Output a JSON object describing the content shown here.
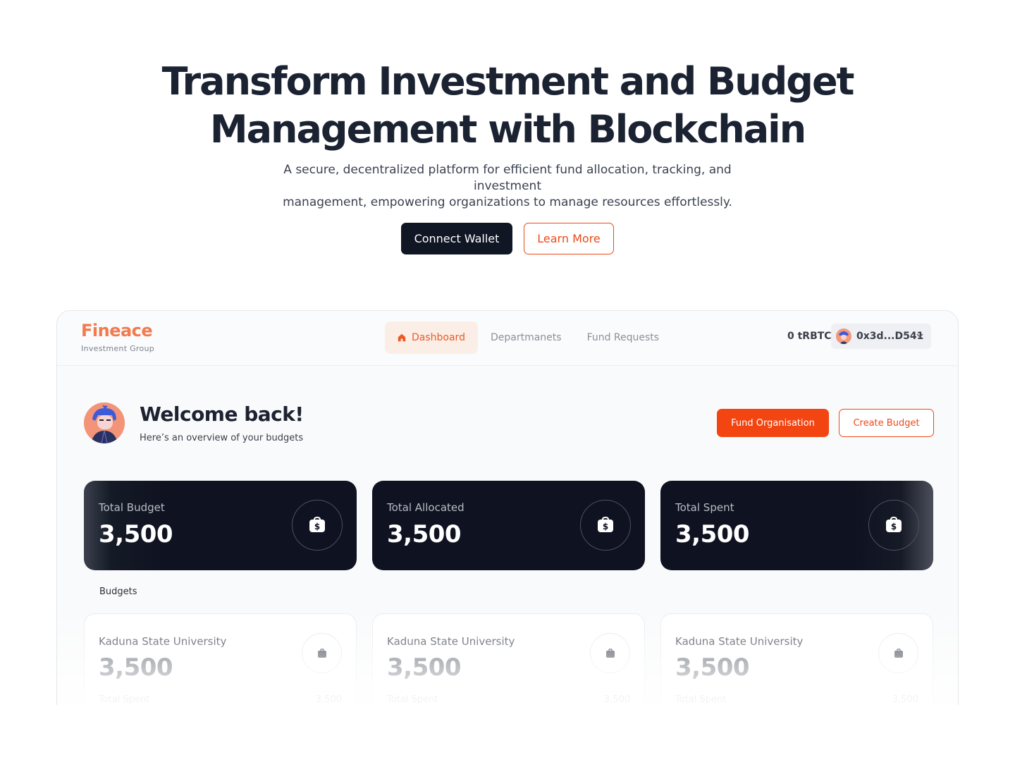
{
  "hero": {
    "title_line1": "Transform Investment and Budget",
    "title_line2": "Management with Blockchain",
    "subtitle_line1": "A secure, decentralized platform for efficient fund allocation, tracking, and investment",
    "subtitle_line2": "management, empowering organizations to manage resources effortlessly.",
    "connect_label": "Connect Wallet",
    "learn_label": "Learn More"
  },
  "app": {
    "logo": {
      "name": "Fineace",
      "tagline": "Investment Group"
    },
    "nav": [
      {
        "label": "Dashboard",
        "icon": "home-icon",
        "active": true
      },
      {
        "label": "Departmanets",
        "active": false
      },
      {
        "label": "Fund Requests",
        "active": false
      }
    ],
    "balance": "0 tRBTC",
    "wallet": {
      "address": "0x3d...D541",
      "icon": "chevron-down-icon"
    },
    "welcome": {
      "title": "Welcome back!",
      "subtitle": "Here’s an overview of your budgets"
    },
    "actions": {
      "fund_label": "Fund Organisation",
      "create_label": "Create Budget"
    },
    "stats": [
      {
        "label": "Total Budget",
        "value": "3,500",
        "icon": "money-bag-icon"
      },
      {
        "label": "Total Allocated",
        "value": "3,500",
        "icon": "money-bag-icon"
      },
      {
        "label": "Total Spent",
        "value": "3,500",
        "icon": "money-bag-icon"
      }
    ],
    "budgets_label": "Budgets",
    "budgets": [
      {
        "name": "Kaduna State University",
        "value": "3,500",
        "foot_label": "Total Spent",
        "foot_value": "3,500",
        "icon": "briefcase-icon"
      },
      {
        "name": "Kaduna State University",
        "value": "3,500",
        "foot_label": "Total Spent",
        "foot_value": "3,500",
        "icon": "briefcase-icon"
      },
      {
        "name": "Kaduna State University",
        "value": "3,500",
        "foot_label": "Total Spent",
        "foot_value": "3,500",
        "icon": "briefcase-icon"
      }
    ]
  },
  "colors": {
    "accent": "#F24511",
    "logo": "#F27A4E",
    "dark": "#0F1220",
    "nav_active_bg": "#FBEEE7"
  }
}
